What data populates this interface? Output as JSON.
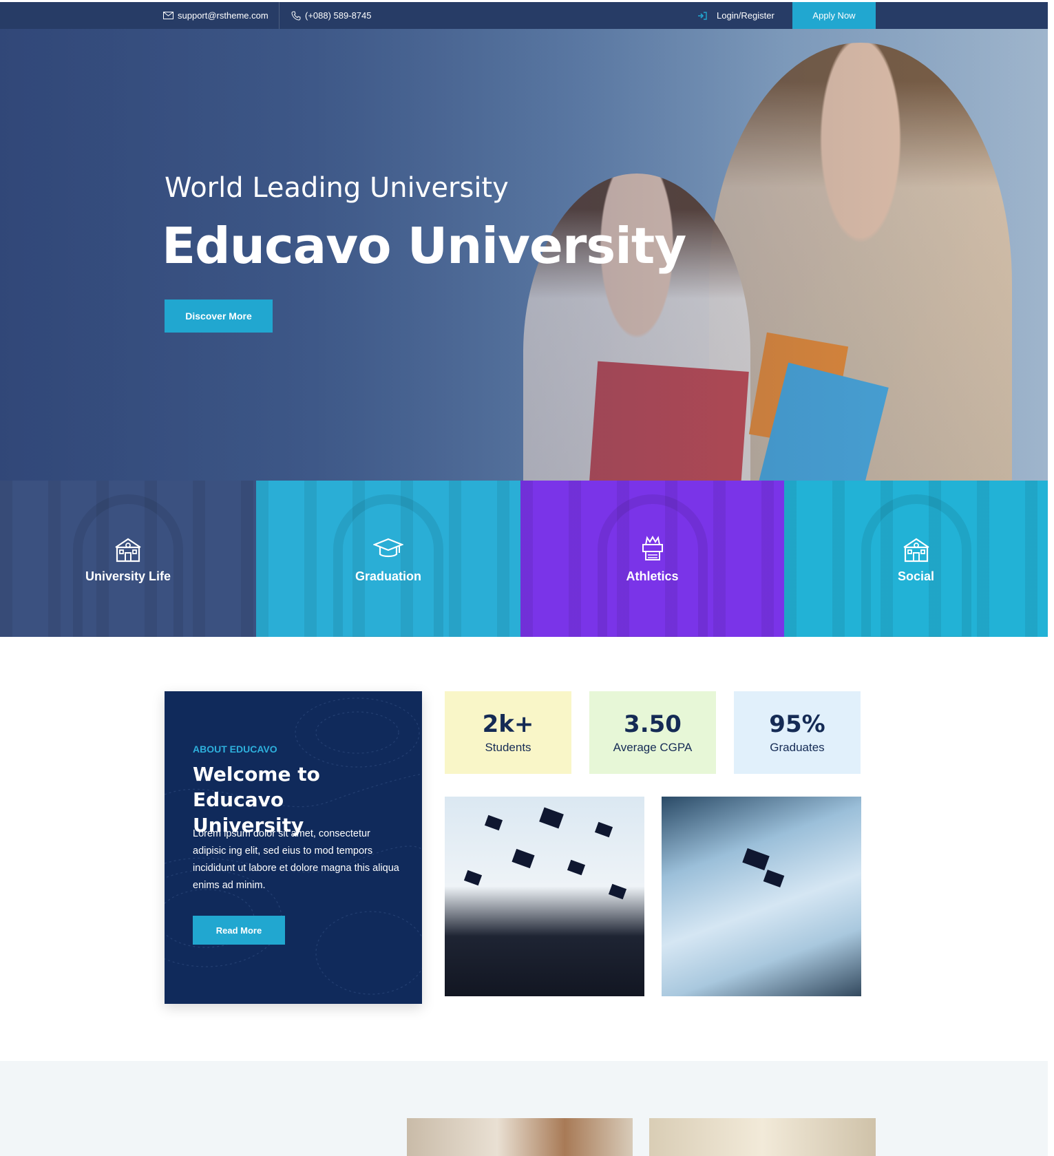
{
  "topbar": {
    "email": "support@rstheme.com",
    "phone": "(+088) 589-8745",
    "login": "Login/Register",
    "apply": "Apply Now"
  },
  "hero": {
    "subtitle": "World Leading University",
    "title": "Educavo University",
    "cta": "Discover More"
  },
  "categories": [
    {
      "label": "University Life",
      "icon": "school-building-icon",
      "color": "#3b5180"
    },
    {
      "label": "Graduation",
      "icon": "graduation-cap-icon",
      "color": "#2aaed6"
    },
    {
      "label": "Athletics",
      "icon": "trophy-icon",
      "color": "#7a34e8"
    },
    {
      "label": "Social",
      "icon": "school-building-icon",
      "color": "#22b2d6"
    }
  ],
  "about": {
    "eyebrow": "ABOUT EDUCAVO",
    "heading": "Welcome to Educavo University",
    "body": "Lorem ipsum dolor sit amet, consectetur adipisic ing elit, sed eius to mod tempors incididunt ut labore et dolore magna this aliqua enims ad minim.",
    "cta": "Read More"
  },
  "stats": [
    {
      "value": "2k+",
      "label": "Students",
      "color": "#f9f6c8"
    },
    {
      "value": "3.50",
      "label": "Average CGPA",
      "color": "#e7f7d7"
    },
    {
      "value": "95%",
      "label": "Graduates",
      "color": "#e1f0fb"
    }
  ],
  "colors": {
    "topbar": "#273c66",
    "accent": "#21a7d0",
    "about_bg": "#102a5b",
    "stat_text": "#152b55"
  }
}
